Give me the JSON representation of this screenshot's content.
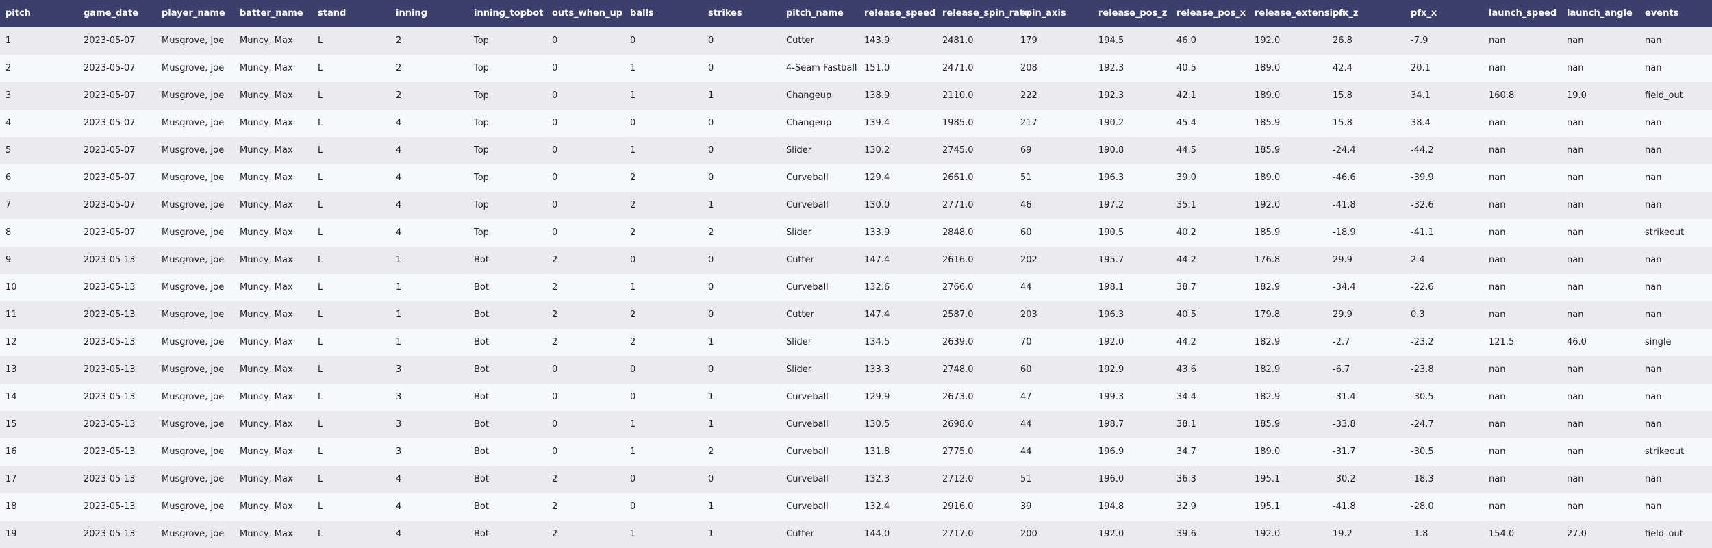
{
  "chart_data": {
    "type": "table",
    "columns": [
      "pitch",
      "game_date",
      "player_name",
      "batter_name",
      "stand",
      "inning",
      "inning_topbot",
      "outs_when_up",
      "balls",
      "strikes",
      "pitch_name",
      "release_speed",
      "release_spin_rate",
      "spin_axis",
      "release_pos_z",
      "release_pos_x",
      "release_extension",
      "pfx_z",
      "pfx_x",
      "launch_speed",
      "launch_angle",
      "events"
    ],
    "rows": [
      [
        "1",
        "2023-05-07",
        "Musgrove, Joe",
        "Muncy, Max",
        "L",
        "2",
        "Top",
        "0",
        "0",
        "0",
        "Cutter",
        "143.9",
        "2481.0",
        "179",
        "194.5",
        "46.0",
        "192.0",
        "26.8",
        "-7.9",
        "nan",
        "nan",
        "nan"
      ],
      [
        "2",
        "2023-05-07",
        "Musgrove, Joe",
        "Muncy, Max",
        "L",
        "2",
        "Top",
        "0",
        "1",
        "0",
        "4-Seam Fastball",
        "151.0",
        "2471.0",
        "208",
        "192.3",
        "40.5",
        "189.0",
        "42.4",
        "20.1",
        "nan",
        "nan",
        "nan"
      ],
      [
        "3",
        "2023-05-07",
        "Musgrove, Joe",
        "Muncy, Max",
        "L",
        "2",
        "Top",
        "0",
        "1",
        "1",
        "Changeup",
        "138.9",
        "2110.0",
        "222",
        "192.3",
        "42.1",
        "189.0",
        "15.8",
        "34.1",
        "160.8",
        "19.0",
        "field_out"
      ],
      [
        "4",
        "2023-05-07",
        "Musgrove, Joe",
        "Muncy, Max",
        "L",
        "4",
        "Top",
        "0",
        "0",
        "0",
        "Changeup",
        "139.4",
        "1985.0",
        "217",
        "190.2",
        "45.4",
        "185.9",
        "15.8",
        "38.4",
        "nan",
        "nan",
        "nan"
      ],
      [
        "5",
        "2023-05-07",
        "Musgrove, Joe",
        "Muncy, Max",
        "L",
        "4",
        "Top",
        "0",
        "1",
        "0",
        "Slider",
        "130.2",
        "2745.0",
        "69",
        "190.8",
        "44.5",
        "185.9",
        "-24.4",
        "-44.2",
        "nan",
        "nan",
        "nan"
      ],
      [
        "6",
        "2023-05-07",
        "Musgrove, Joe",
        "Muncy, Max",
        "L",
        "4",
        "Top",
        "0",
        "2",
        "0",
        "Curveball",
        "129.4",
        "2661.0",
        "51",
        "196.3",
        "39.0",
        "189.0",
        "-46.6",
        "-39.9",
        "nan",
        "nan",
        "nan"
      ],
      [
        "7",
        "2023-05-07",
        "Musgrove, Joe",
        "Muncy, Max",
        "L",
        "4",
        "Top",
        "0",
        "2",
        "1",
        "Curveball",
        "130.0",
        "2771.0",
        "46",
        "197.2",
        "35.1",
        "192.0",
        "-41.8",
        "-32.6",
        "nan",
        "nan",
        "nan"
      ],
      [
        "8",
        "2023-05-07",
        "Musgrove, Joe",
        "Muncy, Max",
        "L",
        "4",
        "Top",
        "0",
        "2",
        "2",
        "Slider",
        "133.9",
        "2848.0",
        "60",
        "190.5",
        "40.2",
        "185.9",
        "-18.9",
        "-41.1",
        "nan",
        "nan",
        "strikeout"
      ],
      [
        "9",
        "2023-05-13",
        "Musgrove, Joe",
        "Muncy, Max",
        "L",
        "1",
        "Bot",
        "2",
        "0",
        "0",
        "Cutter",
        "147.4",
        "2616.0",
        "202",
        "195.7",
        "44.2",
        "176.8",
        "29.9",
        "2.4",
        "nan",
        "nan",
        "nan"
      ],
      [
        "10",
        "2023-05-13",
        "Musgrove, Joe",
        "Muncy, Max",
        "L",
        "1",
        "Bot",
        "2",
        "1",
        "0",
        "Curveball",
        "132.6",
        "2766.0",
        "44",
        "198.1",
        "38.7",
        "182.9",
        "-34.4",
        "-22.6",
        "nan",
        "nan",
        "nan"
      ],
      [
        "11",
        "2023-05-13",
        "Musgrove, Joe",
        "Muncy, Max",
        "L",
        "1",
        "Bot",
        "2",
        "2",
        "0",
        "Cutter",
        "147.4",
        "2587.0",
        "203",
        "196.3",
        "40.5",
        "179.8",
        "29.9",
        "0.3",
        "nan",
        "nan",
        "nan"
      ],
      [
        "12",
        "2023-05-13",
        "Musgrove, Joe",
        "Muncy, Max",
        "L",
        "1",
        "Bot",
        "2",
        "2",
        "1",
        "Slider",
        "134.5",
        "2639.0",
        "70",
        "192.0",
        "44.2",
        "182.9",
        "-2.7",
        "-23.2",
        "121.5",
        "46.0",
        "single"
      ],
      [
        "13",
        "2023-05-13",
        "Musgrove, Joe",
        "Muncy, Max",
        "L",
        "3",
        "Bot",
        "0",
        "0",
        "0",
        "Slider",
        "133.3",
        "2748.0",
        "60",
        "192.9",
        "43.6",
        "182.9",
        "-6.7",
        "-23.8",
        "nan",
        "nan",
        "nan"
      ],
      [
        "14",
        "2023-05-13",
        "Musgrove, Joe",
        "Muncy, Max",
        "L",
        "3",
        "Bot",
        "0",
        "0",
        "1",
        "Curveball",
        "129.9",
        "2673.0",
        "47",
        "199.3",
        "34.4",
        "182.9",
        "-31.4",
        "-30.5",
        "nan",
        "nan",
        "nan"
      ],
      [
        "15",
        "2023-05-13",
        "Musgrove, Joe",
        "Muncy, Max",
        "L",
        "3",
        "Bot",
        "0",
        "1",
        "1",
        "Curveball",
        "130.5",
        "2698.0",
        "44",
        "198.7",
        "38.1",
        "185.9",
        "-33.8",
        "-24.7",
        "nan",
        "nan",
        "nan"
      ],
      [
        "16",
        "2023-05-13",
        "Musgrove, Joe",
        "Muncy, Max",
        "L",
        "3",
        "Bot",
        "0",
        "1",
        "2",
        "Curveball",
        "131.8",
        "2775.0",
        "44",
        "196.9",
        "34.7",
        "189.0",
        "-31.7",
        "-30.5",
        "nan",
        "nan",
        "strikeout"
      ],
      [
        "17",
        "2023-05-13",
        "Musgrove, Joe",
        "Muncy, Max",
        "L",
        "4",
        "Bot",
        "2",
        "0",
        "0",
        "Curveball",
        "132.3",
        "2712.0",
        "51",
        "196.0",
        "36.3",
        "195.1",
        "-30.2",
        "-18.3",
        "nan",
        "nan",
        "nan"
      ],
      [
        "18",
        "2023-05-13",
        "Musgrove, Joe",
        "Muncy, Max",
        "L",
        "4",
        "Bot",
        "2",
        "0",
        "1",
        "Curveball",
        "132.4",
        "2916.0",
        "39",
        "194.8",
        "32.9",
        "195.1",
        "-41.8",
        "-28.0",
        "nan",
        "nan",
        "nan"
      ],
      [
        "19",
        "2023-05-13",
        "Musgrove, Joe",
        "Muncy, Max",
        "L",
        "4",
        "Bot",
        "2",
        "1",
        "1",
        "Cutter",
        "144.0",
        "2717.0",
        "200",
        "192.0",
        "39.6",
        "192.0",
        "19.2",
        "-1.8",
        "154.0",
        "27.0",
        "field_out"
      ]
    ]
  },
  "colors": {
    "header_bg": "#3a3f6b",
    "header_text": "#ffffff",
    "row_odd": "#ebebef",
    "row_even": "#f8f9fc",
    "cell_text": "#222222"
  }
}
